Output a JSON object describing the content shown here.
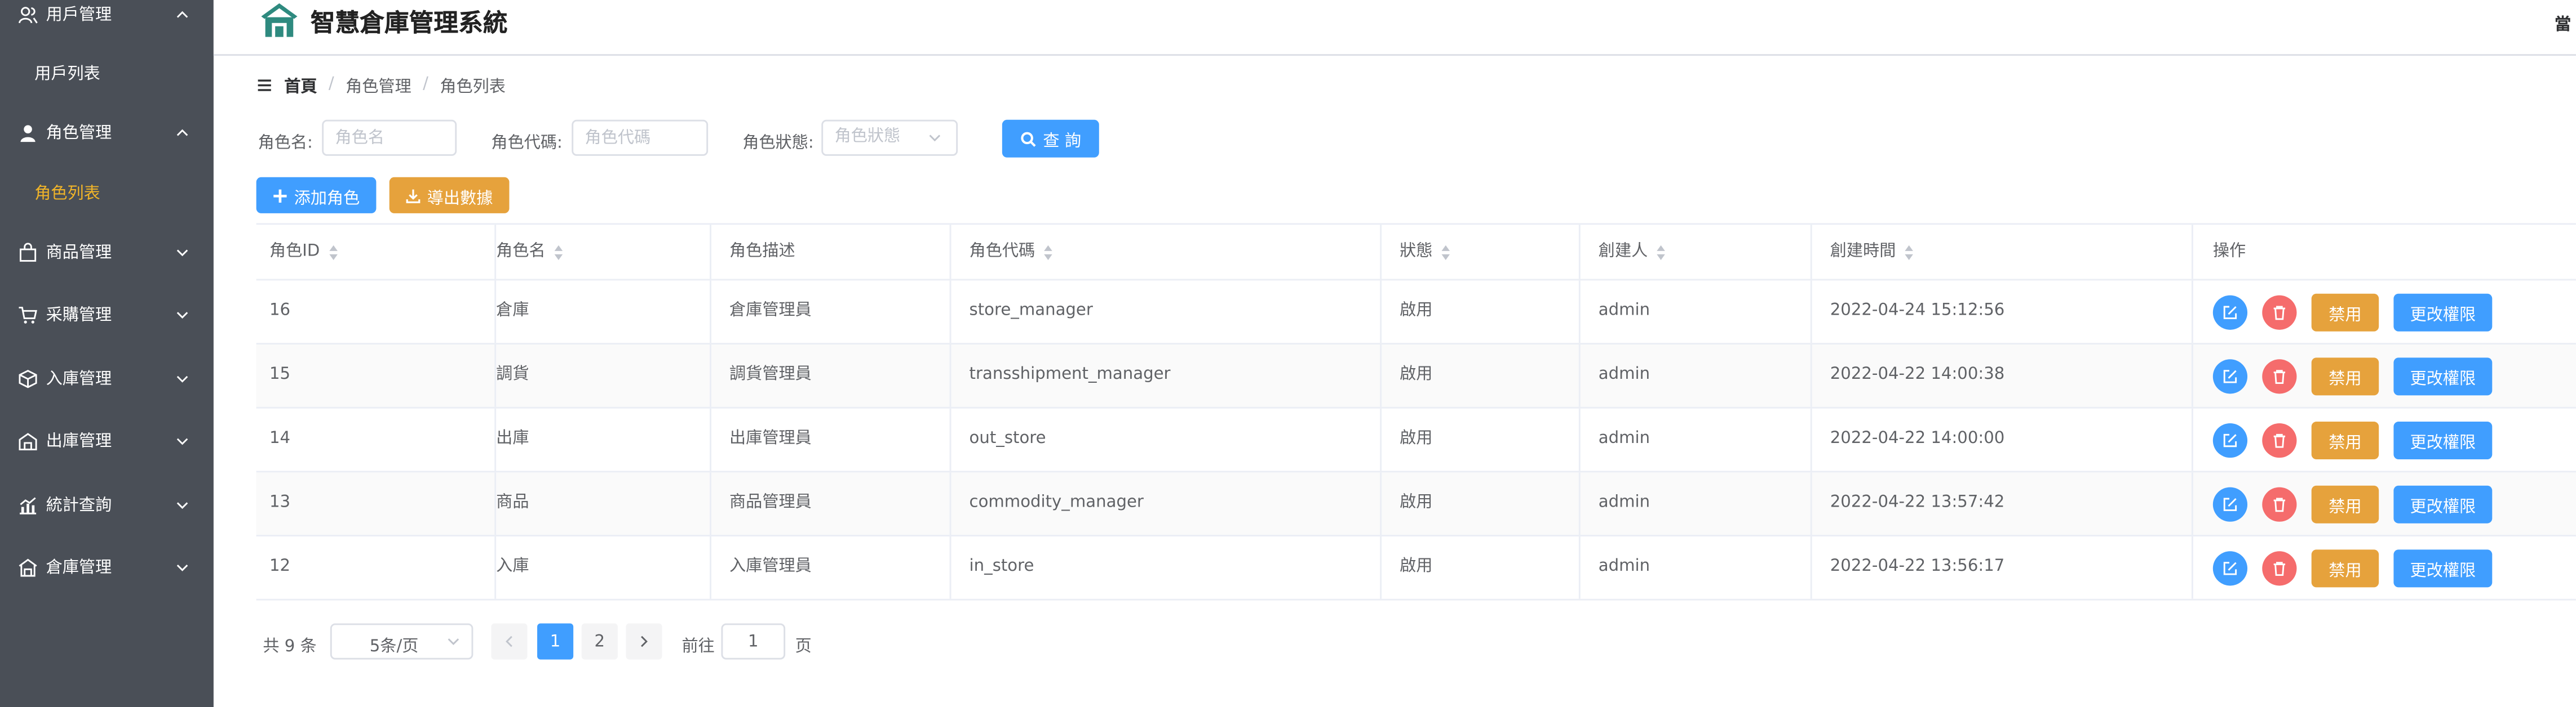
{
  "sidebar": {
    "menus": [
      {
        "label": "用戶管理",
        "icon": "users-icon",
        "expanded": true
      },
      {
        "label": "用戶列表",
        "sub": true
      },
      {
        "label": "角色管理",
        "icon": "user-icon",
        "expanded": true
      },
      {
        "label": "角色列表",
        "sub": true,
        "active": true
      },
      {
        "label": "商品管理",
        "icon": "shopping-bag-icon",
        "expanded": false
      },
      {
        "label": "采購管理",
        "icon": "cart-icon",
        "expanded": false
      },
      {
        "label": "入庫管理",
        "icon": "box-icon",
        "expanded": false
      },
      {
        "label": "出庫管理",
        "icon": "warehouse-out-icon",
        "expanded": false
      },
      {
        "label": "統計查詢",
        "icon": "chart-icon",
        "expanded": false
      },
      {
        "label": "倉庫管理",
        "icon": "warehouse-icon",
        "expanded": false
      }
    ],
    "active_color": "#f0b429",
    "bg_color": "#4a4f57"
  },
  "header": {
    "title": "智慧倉庫管理系統",
    "right_text": "當",
    "logo_icon": "warehouse-logo-icon",
    "logo_color": "#2e8a7f"
  },
  "breadcrumb": {
    "items": [
      "首頁",
      "角色管理",
      "角色列表"
    ],
    "separator": "/"
  },
  "search": {
    "role_name_label": "角色名:",
    "role_name_placeholder": "角色名",
    "role_code_label": "角色代碼:",
    "role_code_placeholder": "角色代碼",
    "role_status_label": "角色狀態:",
    "role_status_placeholder": "角色狀態",
    "query_label": "查 詢"
  },
  "toolbar": {
    "add_label": "添加角色",
    "export_label": "導出數據"
  },
  "colors": {
    "primary": "#409eff",
    "warning": "#e6a23c",
    "danger": "#f56c6c",
    "border": "#ebeef5"
  },
  "table": {
    "columns": [
      "角色ID",
      "角色名",
      "角色描述",
      "角色代碼",
      "狀態",
      "創建人",
      "創建時間",
      "操作"
    ],
    "rows": [
      {
        "id": "16",
        "name": "倉庫",
        "desc": "倉庫管理員",
        "code": "store_manager",
        "status": "啟用",
        "creator": "admin",
        "time": "2022-04-24 15:12:56"
      },
      {
        "id": "15",
        "name": "調貨",
        "desc": "調貨管理員",
        "code": "transshipment_manager",
        "status": "啟用",
        "creator": "admin",
        "time": "2022-04-22 14:00:38"
      },
      {
        "id": "14",
        "name": "出庫",
        "desc": "出庫管理員",
        "code": "out_store",
        "status": "啟用",
        "creator": "admin",
        "time": "2022-04-22 14:00:00"
      },
      {
        "id": "13",
        "name": "商品",
        "desc": "商品管理員",
        "code": "commodity_manager",
        "status": "啟用",
        "creator": "admin",
        "time": "2022-04-22 13:57:42"
      },
      {
        "id": "12",
        "name": "入庫",
        "desc": "入庫管理員",
        "code": "in_store",
        "status": "啟用",
        "creator": "admin",
        "time": "2022-04-22 13:56:17"
      }
    ],
    "row_actions": {
      "disable_label": "禁用",
      "permission_label": "更改權限"
    }
  },
  "pagination": {
    "total_text": "共 9 条",
    "page_size": "5条/页",
    "pages": [
      "1",
      "2"
    ],
    "current_page": "1",
    "goto_label": "前往",
    "goto_value": "1",
    "page_unit": "页"
  }
}
